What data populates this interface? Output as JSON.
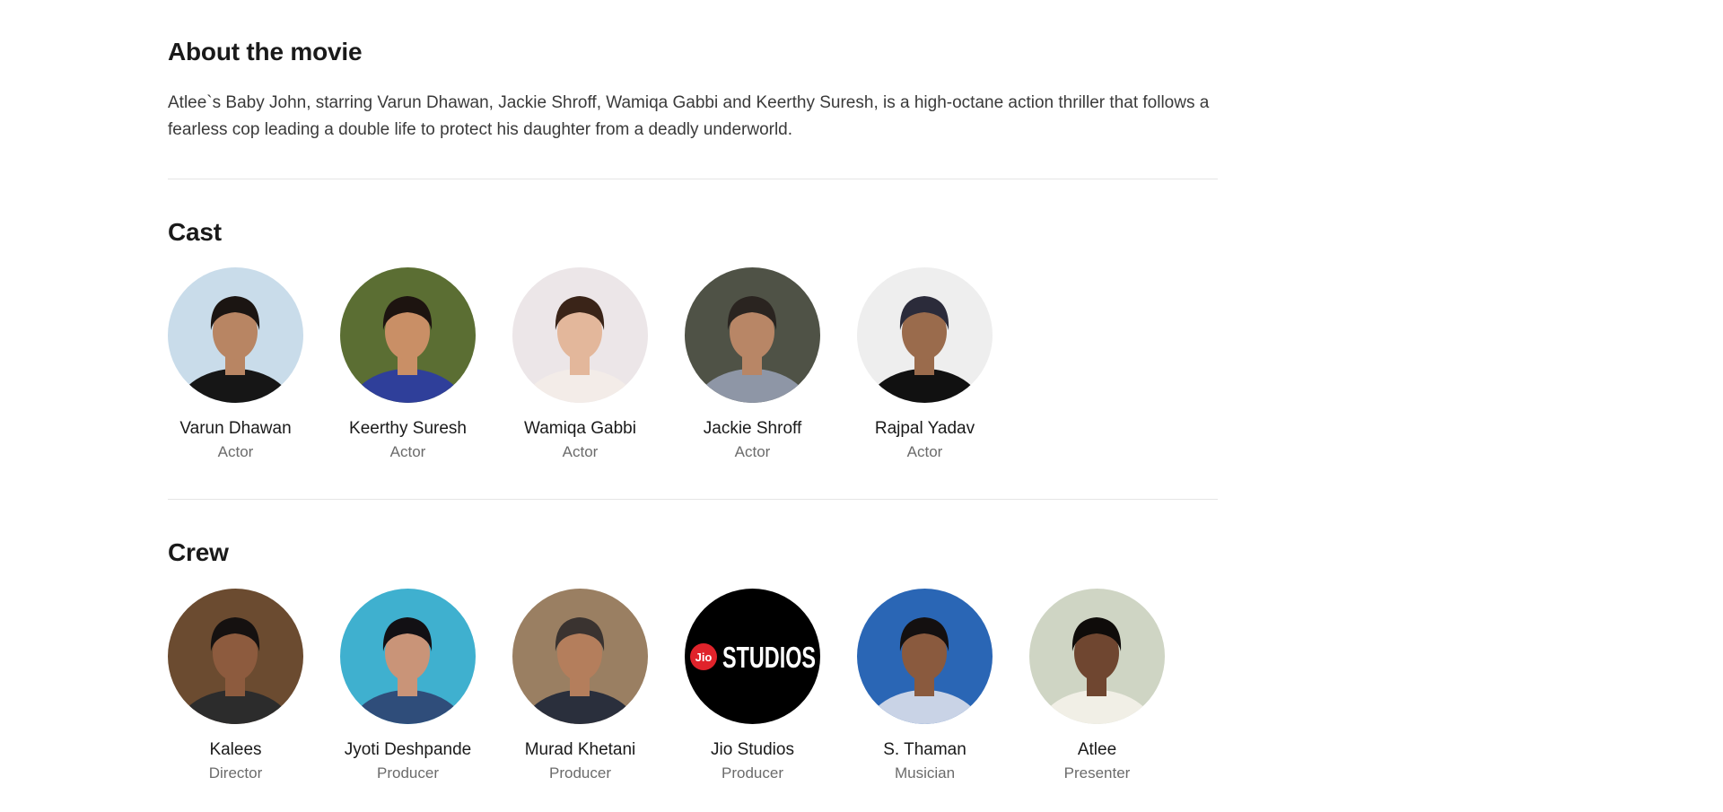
{
  "about": {
    "title": "About the movie",
    "text": "Atlee`s Baby John, starring Varun Dhawan, Jackie Shroff, Wamiqa Gabbi and Keerthy Suresh, is a high-octane action thriller that follows a fearless cop leading a double life to protect his daughter from a deadly underworld."
  },
  "cast": {
    "title": "Cast",
    "people": [
      {
        "name": "Varun Dhawan",
        "role": "Actor",
        "bg": "#c9dcea",
        "skin": "#b88563",
        "hair": "#1b1512",
        "shirt": "#161616"
      },
      {
        "name": "Keerthy Suresh",
        "role": "Actor",
        "bg": "#5b6e33",
        "skin": "#c98f66",
        "hair": "#1d1410",
        "shirt": "#2f3f9a"
      },
      {
        "name": "Wamiqa Gabbi",
        "role": "Actor",
        "bg": "#ece6e8",
        "skin": "#e3b79b",
        "hair": "#3a2418",
        "shirt": "#f3ece8"
      },
      {
        "name": "Jackie Shroff",
        "role": "Actor",
        "bg": "#4f5246",
        "skin": "#b88666",
        "hair": "#2a2420",
        "shirt": "#8e96a6"
      },
      {
        "name": "Rajpal Yadav",
        "role": "Actor",
        "bg": "#eeeeee",
        "skin": "#9a6b4c",
        "hair": "#2b2b3a",
        "shirt": "#111111"
      }
    ]
  },
  "crew": {
    "title": "Crew",
    "people": [
      {
        "name": "Kalees",
        "role": "Director",
        "bg": "#6b4b30",
        "skin": "#8d5b3e",
        "hair": "#151110",
        "shirt": "#2c2c2c"
      },
      {
        "name": "Jyoti Deshpande",
        "role": "Producer",
        "bg": "#3fb0cf",
        "skin": "#c99478",
        "hair": "#121014",
        "shirt": "#2f4d7a"
      },
      {
        "name": "Murad Khetani",
        "role": "Producer",
        "bg": "#9a7f62",
        "skin": "#b47e5c",
        "hair": "#3a3330",
        "shirt": "#2a2f3c"
      },
      {
        "name": "Jio Studios",
        "role": "Producer",
        "bg": "#000000",
        "logo": {
          "badge": "Jio",
          "word": "STUDIOS",
          "badge_color": "#e0232b"
        }
      },
      {
        "name": "S. Thaman",
        "role": "Musician",
        "bg": "#2a66b5",
        "skin": "#8a5a3e",
        "hair": "#141010",
        "shirt": "#c9d3e6"
      },
      {
        "name": "Atlee",
        "role": "Presenter",
        "bg": "#cfd5c4",
        "skin": "#6f4630",
        "hair": "#0f0c0a",
        "shirt": "#f1efe6"
      }
    ]
  }
}
